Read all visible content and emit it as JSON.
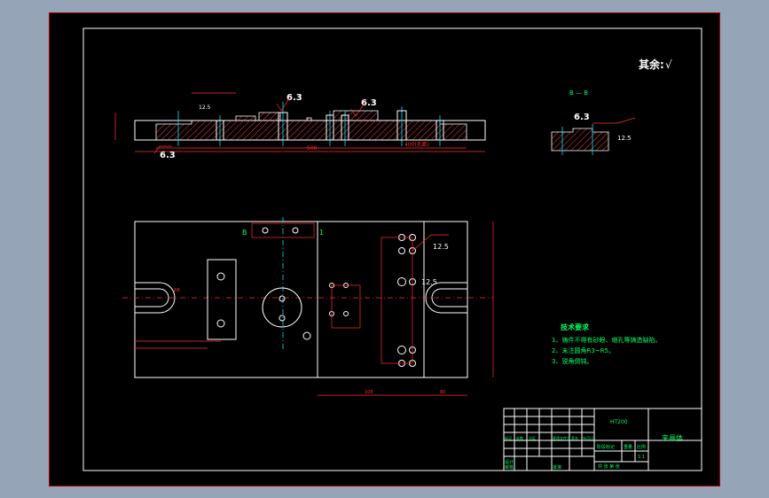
{
  "drawing": {
    "surface_note": "其余:",
    "surface_value": "√",
    "section_label": "B — B",
    "view_label_left": "B",
    "view_label_right": "1",
    "roughness_labels": [
      "6.3",
      "6.3",
      "6.3",
      "12.5",
      "12.5",
      "6.3",
      "12.5",
      "12.5",
      "6.3"
    ],
    "dimension_texts": [
      "500",
      "400(孔距)",
      "R8",
      "100",
      "80",
      "60",
      "180",
      "140",
      "120"
    ],
    "tech_requirements": {
      "title": "技术要求",
      "items": [
        "1、铸件不得有砂眼、缩孔等铸造缺陷。",
        "2、未注圆角R3~R5。",
        "3、锐角倒钝。"
      ]
    }
  },
  "title_block": {
    "part_name": "夹具体",
    "material": "HT200",
    "scale": "1:1",
    "sheet": "共 张 第 张",
    "row_labels": [
      "标记",
      "处数",
      "分区",
      "更改文件号",
      "签名",
      "年月日"
    ],
    "design_label": "设计",
    "check_label": "审核",
    "approve_label": "批准",
    "stage_label": "阶段标记",
    "weight_label": "重量",
    "scale_label": "比例"
  },
  "colors": {
    "background": "#000000",
    "outline": "#ffffff",
    "dimension": "#ff3030",
    "centerline": "#00e5ff",
    "annotation": "#00ff66",
    "window": "#95a5b7"
  }
}
